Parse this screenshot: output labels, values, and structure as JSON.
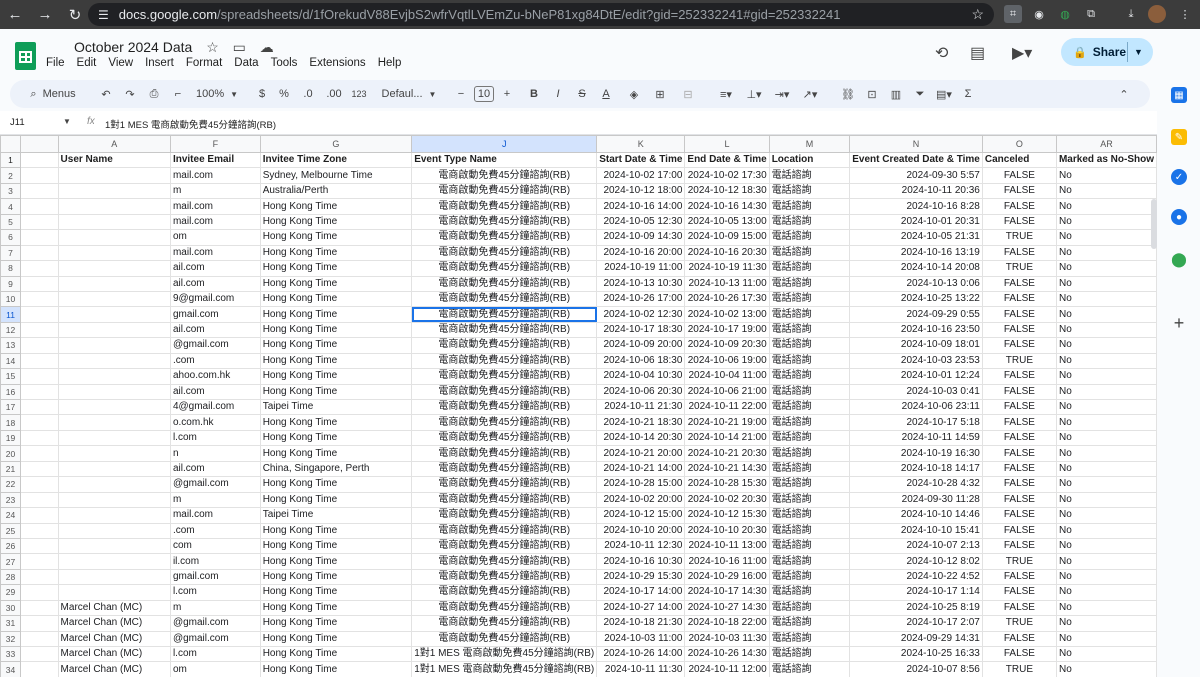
{
  "browser": {
    "url_domain": "docs.google.com",
    "url_path": "/spreadsheets/d/1fOrekudV88EvjbS2wfrVqtlLVEmZu-bNeP81xg84DtE/edit?gid=252332241#gid=252332241"
  },
  "doc": {
    "title": "October 2024 Data",
    "menu": [
      "File",
      "Edit",
      "View",
      "Insert",
      "Format",
      "Data",
      "Tools",
      "Extensions",
      "Help"
    ],
    "share_label": "Share"
  },
  "toolbar": {
    "search": "Menus",
    "zoom": "100%",
    "currency": "$",
    "percent": "%",
    "dec_less": ".0",
    "dec_more": ".00",
    "number_fmt": "123",
    "font": "Defaul...",
    "font_size": "10",
    "bold": "B",
    "italic": "I",
    "sigma": "Σ"
  },
  "formula": {
    "cell": "J11",
    "fx": "fx",
    "content": "1對1 MES 電商啟動免費45分鐘諮詢(RB)"
  },
  "columns": [
    "A",
    "F",
    "G",
    "J",
    "K",
    "L",
    "M",
    "N",
    "O",
    "AR"
  ],
  "headers": [
    "User Name",
    "Invitee Email",
    "Invitee Time Zone",
    "Event Type Name",
    "Start Date & Time",
    "End Date & Time",
    "Location",
    "Event Created Date & Time",
    "Canceled",
    "Marked as No-Show"
  ],
  "rows": [
    [
      "2",
      "",
      "mail.com",
      "Sydney, Melbourne Time",
      "電商啟動免費45分鐘諮詢(RB)",
      "2024-10-02 17:00",
      "2024-10-02 17:30",
      "電話諮詢",
      "2024-09-30 5:57",
      "FALSE",
      "No"
    ],
    [
      "3",
      "",
      "m",
      "Australia/Perth",
      "電商啟動免費45分鐘諮詢(RB)",
      "2024-10-12 18:00",
      "2024-10-12 18:30",
      "電話諮詢",
      "2024-10-11 20:36",
      "FALSE",
      "No"
    ],
    [
      "4",
      "",
      "mail.com",
      "Hong Kong Time",
      "電商啟動免費45分鐘諮詢(RB)",
      "2024-10-16 14:00",
      "2024-10-16 14:30",
      "電話諮詢",
      "2024-10-16 8:28",
      "FALSE",
      "No"
    ],
    [
      "5",
      "",
      "mail.com",
      "Hong Kong Time",
      "電商啟動免費45分鐘諮詢(RB)",
      "2024-10-05 12:30",
      "2024-10-05 13:00",
      "電話諮詢",
      "2024-10-01 20:31",
      "FALSE",
      "No"
    ],
    [
      "6",
      "",
      "om",
      "Hong Kong Time",
      "電商啟動免費45分鐘諮詢(RB)",
      "2024-10-09 14:30",
      "2024-10-09 15:00",
      "電話諮詢",
      "2024-10-05 21:31",
      "TRUE",
      "No"
    ],
    [
      "7",
      "",
      "mail.com",
      "Hong Kong Time",
      "電商啟動免費45分鐘諮詢(RB)",
      "2024-10-16 20:00",
      "2024-10-16 20:30",
      "電話諮詢",
      "2024-10-16 13:19",
      "FALSE",
      "No"
    ],
    [
      "8",
      "",
      "ail.com",
      "Hong Kong Time",
      "電商啟動免費45分鐘諮詢(RB)",
      "2024-10-19 11:00",
      "2024-10-19 11:30",
      "電話諮詢",
      "2024-10-14 20:08",
      "TRUE",
      "No"
    ],
    [
      "9",
      "",
      "ail.com",
      "Hong Kong Time",
      "電商啟動免費45分鐘諮詢(RB)",
      "2024-10-13 10:30",
      "2024-10-13 11:00",
      "電話諮詢",
      "2024-10-13 0:06",
      "FALSE",
      "No"
    ],
    [
      "10",
      "",
      "9@gmail.com",
      "Hong Kong Time",
      "電商啟動免費45分鐘諮詢(RB)",
      "2024-10-26 17:00",
      "2024-10-26 17:30",
      "電話諮詢",
      "2024-10-25 13:22",
      "FALSE",
      "No"
    ],
    [
      "11",
      "",
      "gmail.com",
      "Hong Kong Time",
      "電商啟動免費45分鐘諮詢(RB)",
      "2024-10-02 12:30",
      "2024-10-02 13:00",
      "電話諮詢",
      "2024-09-29 0:55",
      "FALSE",
      "No"
    ],
    [
      "12",
      "",
      "ail.com",
      "Hong Kong Time",
      "電商啟動免費45分鐘諮詢(RB)",
      "2024-10-17 18:30",
      "2024-10-17 19:00",
      "電話諮詢",
      "2024-10-16 23:50",
      "FALSE",
      "No"
    ],
    [
      "13",
      "",
      "@gmail.com",
      "Hong Kong Time",
      "電商啟動免費45分鐘諮詢(RB)",
      "2024-10-09 20:00",
      "2024-10-09 20:30",
      "電話諮詢",
      "2024-10-09 18:01",
      "FALSE",
      "No"
    ],
    [
      "14",
      "",
      ".com",
      "Hong Kong Time",
      "電商啟動免費45分鐘諮詢(RB)",
      "2024-10-06 18:30",
      "2024-10-06 19:00",
      "電話諮詢",
      "2024-10-03 23:53",
      "TRUE",
      "No"
    ],
    [
      "15",
      "",
      "ahoo.com.hk",
      "Hong Kong Time",
      "電商啟動免費45分鐘諮詢(RB)",
      "2024-10-04 10:30",
      "2024-10-04 11:00",
      "電話諮詢",
      "2024-10-01 12:24",
      "FALSE",
      "No"
    ],
    [
      "16",
      "",
      "ail.com",
      "Hong Kong Time",
      "電商啟動免費45分鐘諮詢(RB)",
      "2024-10-06 20:30",
      "2024-10-06 21:00",
      "電話諮詢",
      "2024-10-03 0:41",
      "FALSE",
      "No"
    ],
    [
      "17",
      "",
      "4@gmail.com",
      "Taipei Time",
      "電商啟動免費45分鐘諮詢(RB)",
      "2024-10-11 21:30",
      "2024-10-11 22:00",
      "電話諮詢",
      "2024-10-06 23:11",
      "FALSE",
      "No"
    ],
    [
      "18",
      "",
      "o.com.hk",
      "Hong Kong Time",
      "電商啟動免費45分鐘諮詢(RB)",
      "2024-10-21 18:30",
      "2024-10-21 19:00",
      "電話諮詢",
      "2024-10-17 5:18",
      "FALSE",
      "No"
    ],
    [
      "19",
      "",
      "l.com",
      "Hong Kong Time",
      "電商啟動免費45分鐘諮詢(RB)",
      "2024-10-14 20:30",
      "2024-10-14 21:00",
      "電話諮詢",
      "2024-10-11 14:59",
      "FALSE",
      "No"
    ],
    [
      "20",
      "",
      "n",
      "Hong Kong Time",
      "電商啟動免費45分鐘諮詢(RB)",
      "2024-10-21 20:00",
      "2024-10-21 20:30",
      "電話諮詢",
      "2024-10-19 16:30",
      "FALSE",
      "No"
    ],
    [
      "21",
      "",
      "ail.com",
      "China, Singapore, Perth",
      "電商啟動免費45分鐘諮詢(RB)",
      "2024-10-21 14:00",
      "2024-10-21 14:30",
      "電話諮詢",
      "2024-10-18 14:17",
      "FALSE",
      "No"
    ],
    [
      "22",
      "",
      "@gmail.com",
      "Hong Kong Time",
      "電商啟動免費45分鐘諮詢(RB)",
      "2024-10-28 15:00",
      "2024-10-28 15:30",
      "電話諮詢",
      "2024-10-28 4:32",
      "FALSE",
      "No"
    ],
    [
      "23",
      "",
      "m",
      "Hong Kong Time",
      "電商啟動免費45分鐘諮詢(RB)",
      "2024-10-02 20:00",
      "2024-10-02 20:30",
      "電話諮詢",
      "2024-09-30 11:28",
      "FALSE",
      "No"
    ],
    [
      "24",
      "",
      "mail.com",
      "Taipei Time",
      "電商啟動免費45分鐘諮詢(RB)",
      "2024-10-12 15:00",
      "2024-10-12 15:30",
      "電話諮詢",
      "2024-10-10 14:46",
      "FALSE",
      "No"
    ],
    [
      "25",
      "",
      ".com",
      "Hong Kong Time",
      "電商啟動免費45分鐘諮詢(RB)",
      "2024-10-10 20:00",
      "2024-10-10 20:30",
      "電話諮詢",
      "2024-10-10 15:41",
      "FALSE",
      "No"
    ],
    [
      "26",
      "",
      "com",
      "Hong Kong Time",
      "電商啟動免費45分鐘諮詢(RB)",
      "2024-10-11 12:30",
      "2024-10-11 13:00",
      "電話諮詢",
      "2024-10-07 2:13",
      "FALSE",
      "No"
    ],
    [
      "27",
      "",
      "il.com",
      "Hong Kong Time",
      "電商啟動免費45分鐘諮詢(RB)",
      "2024-10-16 10:30",
      "2024-10-16 11:00",
      "電話諮詢",
      "2024-10-12 8:02",
      "TRUE",
      "No"
    ],
    [
      "28",
      "",
      "gmail.com",
      "Hong Kong Time",
      "電商啟動免費45分鐘諮詢(RB)",
      "2024-10-29 15:30",
      "2024-10-29 16:00",
      "電話諮詢",
      "2024-10-22 4:52",
      "FALSE",
      "No"
    ],
    [
      "29",
      "",
      "l.com",
      "Hong Kong Time",
      "電商啟動免費45分鐘諮詢(RB)",
      "2024-10-17 14:00",
      "2024-10-17 14:30",
      "電話諮詢",
      "2024-10-17 1:14",
      "FALSE",
      "No"
    ],
    [
      "30",
      "Marcel Chan (MC)",
      "m",
      "Hong Kong Time",
      "電商啟動免費45分鐘諮詢(RB)",
      "2024-10-27 14:00",
      "2024-10-27 14:30",
      "電話諮詢",
      "2024-10-25 8:19",
      "FALSE",
      "No"
    ],
    [
      "31",
      "Marcel Chan (MC)",
      "@gmail.com",
      "Hong Kong Time",
      "電商啟動免費45分鐘諮詢(RB)",
      "2024-10-18 21:30",
      "2024-10-18 22:00",
      "電話諮詢",
      "2024-10-17 2:07",
      "TRUE",
      "No"
    ],
    [
      "32",
      "Marcel Chan (MC)",
      "@gmail.com",
      "Hong Kong Time",
      "電商啟動免費45分鐘諮詢(RB)",
      "2024-10-03 11:00",
      "2024-10-03 11:30",
      "電話諮詢",
      "2024-09-29 14:31",
      "FALSE",
      "No"
    ],
    [
      "33",
      "Marcel Chan (MC)",
      "l.com",
      "Hong Kong Time",
      "1對1 MES 電商啟動免費45分鐘諮詢(RB)",
      "2024-10-26 14:00",
      "2024-10-26 14:30",
      "電話諮詢",
      "2024-10-25 16:33",
      "FALSE",
      "No"
    ],
    [
      "34",
      "Marcel Chan (MC)",
      "om",
      "Hong Kong Time",
      "1對1 MES 電商啟動免費45分鐘諮詢(RB)",
      "2024-10-11 11:30",
      "2024-10-11 12:00",
      "電話諮詢",
      "2024-10-07 8:56",
      "TRUE",
      "No"
    ]
  ]
}
